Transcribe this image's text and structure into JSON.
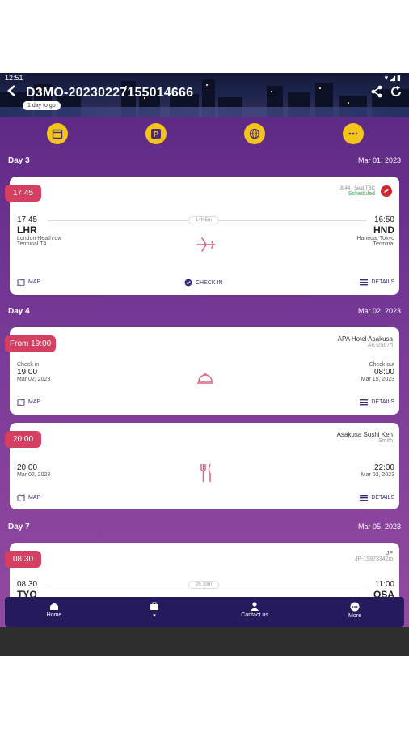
{
  "status_bar": {
    "time": "12:51"
  },
  "header": {
    "title": "D3MO-20230227155014666",
    "countdown": "1 day to go"
  },
  "actions": [
    {
      "icon": "calendar-icon"
    },
    {
      "icon": "parking-icon"
    },
    {
      "icon": "globe-icon"
    },
    {
      "icon": "more-icon"
    }
  ],
  "days": [
    {
      "label": "Day 3",
      "date": "Mar 01, 2023"
    },
    {
      "label": "Day 4",
      "date": "Mar 02, 2023"
    },
    {
      "label": "Day 7",
      "date": "Mar 05, 2023"
    }
  ],
  "flight1": {
    "badge": "17:45",
    "flight_no": "JL44",
    "seat": "Seat TBC",
    "status": "Scheduled",
    "dep_time": "17:45",
    "dep_code": "LHR",
    "dep_airport": "London Heathrow",
    "dep_terminal": "Terminal T4",
    "duration": "14h 5m",
    "arr_time": "16:50",
    "arr_code": "HND",
    "arr_airport": "Haneda, Tokyo",
    "arr_terminal": "Terminal",
    "map": "MAP",
    "checkin": "CHECK IN",
    "details": "DETAILS"
  },
  "hotel": {
    "badge": "From 19:00",
    "name": "APA Hotel Asakusa",
    "ref": "AK-2587h",
    "checkin_label": "Check in",
    "checkin_time": "19:00",
    "checkin_date": "Mar 02, 2023",
    "checkout_label": "Check out",
    "checkout_time": "08:00",
    "checkout_date": "Mar 15, 2023",
    "map": "MAP",
    "details": "DETAILS"
  },
  "dining": {
    "badge": "20:00",
    "name": "Asakusa Sushi Ken",
    "by": "Smith",
    "start_time": "20:00",
    "start_date": "Mar 02, 2023",
    "end_time": "22:00",
    "end_date": "Mar 03, 2023",
    "map": "MAP",
    "details": "DETAILS"
  },
  "flight2": {
    "badge": "08:30",
    "carrier": "JP",
    "ref": "JP-19873342ib",
    "dep_time": "08:30",
    "dep_code": "TYO",
    "duration": "2h 30m",
    "arr_time": "11:00",
    "arr_code": "OSA"
  },
  "tabs": [
    {
      "label": "Home"
    },
    {
      "label": ""
    },
    {
      "label": "Contact us"
    },
    {
      "label": "More"
    }
  ]
}
